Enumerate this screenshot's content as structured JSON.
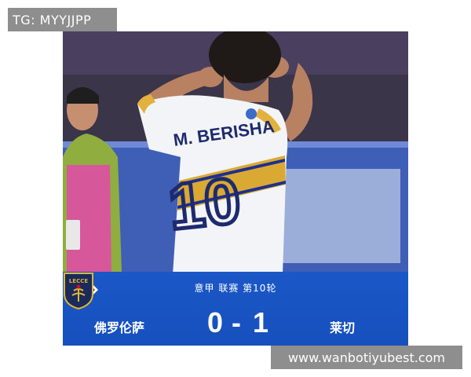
{
  "watermark_top": "TG: MYYJJPP",
  "watermark_bottom": "www.wanbotiyubest.com",
  "player": {
    "shirt_name": "M. BERISHA",
    "shirt_number": "10"
  },
  "scoreboard": {
    "round": "意甲 联赛 第10轮",
    "home_team": "佛罗伦萨",
    "away_team": "莱切",
    "home_score": "0",
    "separator": "-",
    "away_score": "1",
    "away_crest_text": "LECCE"
  },
  "colors": {
    "panel_blue": "#1b57c7",
    "fiorentina_purple": "#5b2a86",
    "lecce_navy": "#1b2a5c",
    "lecce_gold": "#e1b52e"
  }
}
